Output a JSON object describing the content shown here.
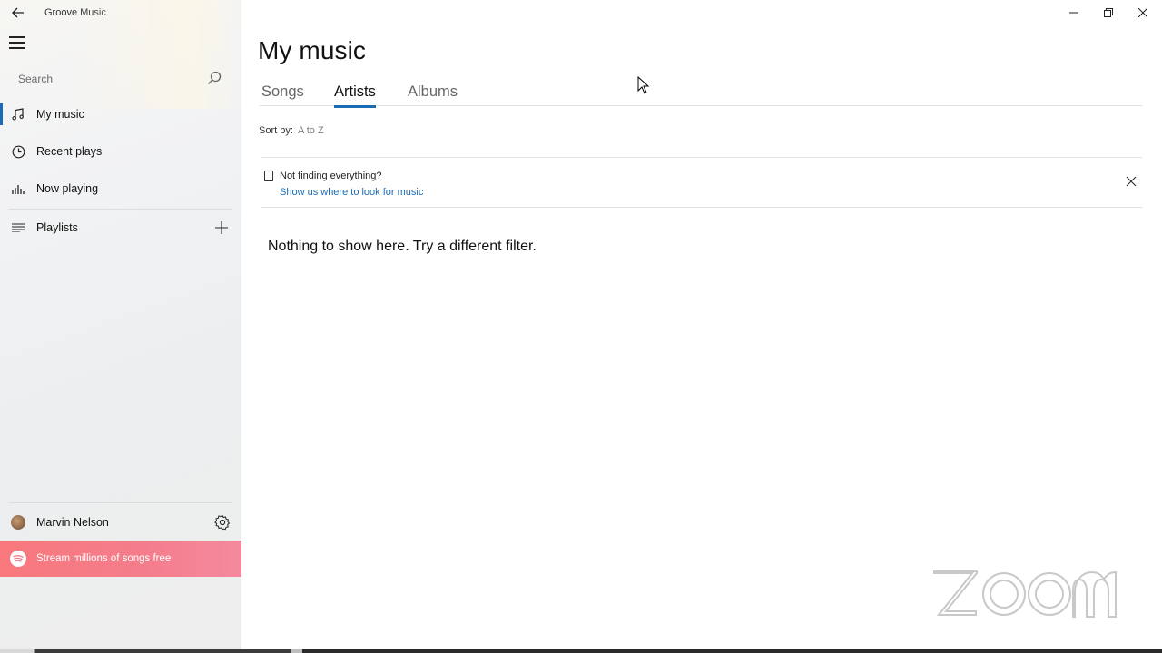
{
  "window": {
    "app_title": "Groove Music",
    "controls": {
      "minimize_icon": "minimize-icon",
      "restore_icon": "restore-icon",
      "close_icon": "close-icon"
    }
  },
  "sidebar": {
    "search": {
      "placeholder": "Search"
    },
    "items": [
      {
        "label": "My music",
        "icon": "music-note-icon",
        "active": true
      },
      {
        "label": "Recent plays",
        "icon": "clock-icon",
        "active": false
      },
      {
        "label": "Now playing",
        "icon": "equalizer-icon",
        "active": false
      }
    ],
    "playlists": {
      "label": "Playlists",
      "icon": "list-icon",
      "add_icon": "plus-icon"
    },
    "user": {
      "name": "Marvin Nelson"
    },
    "promo": {
      "label": "Stream millions of songs free"
    }
  },
  "main": {
    "title": "My music",
    "tabs": [
      {
        "label": "Songs",
        "active": false
      },
      {
        "label": "Artists",
        "active": true
      },
      {
        "label": "Albums",
        "active": false
      }
    ],
    "sort": {
      "label": "Sort by:",
      "value": "A to Z"
    },
    "notice": {
      "title": "Not finding everything?",
      "link": "Show us where to look for music"
    },
    "empty_message": "Nothing to show here. Try a different filter."
  },
  "colors": {
    "accent": "#1a6bb5",
    "promo": "#f47d8c"
  }
}
